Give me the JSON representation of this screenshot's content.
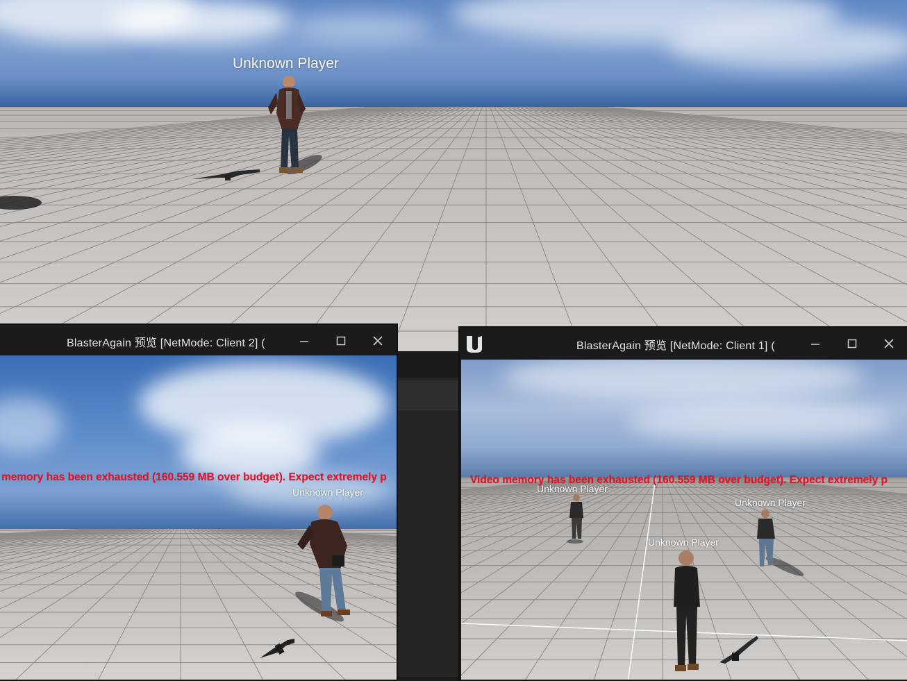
{
  "main_viewport": {
    "player_label": "Unknown Player"
  },
  "client2_window": {
    "title": "BlasterAgain 预览 [NetMode: Client 2]  (",
    "warning": "memory has been exhausted (160.559 MB over budget). Expect extremely p",
    "player_label": "Unknown Player",
    "icons": [
      "minimize-icon",
      "maximize-icon",
      "close-icon"
    ]
  },
  "client1_window": {
    "title": "BlasterAgain 预览 [NetMode: Client 1]  (",
    "warning": "Video memory has been exhausted (160.559 MB over budget). Expect extremely p",
    "player_labels": [
      "Unknown Player",
      "Unknown Player",
      "Unknown Player"
    ],
    "icons": [
      "unreal-logo-icon",
      "minimize-icon",
      "maximize-icon",
      "close-icon"
    ]
  },
  "colors": {
    "sky_top": "#4a78b8",
    "horizon": "#2f5c99",
    "floor": "#cfcbc8",
    "grid_line": "#8d8a88",
    "warning_red": "#e0142a",
    "titlebar": "#1b1b1b"
  }
}
